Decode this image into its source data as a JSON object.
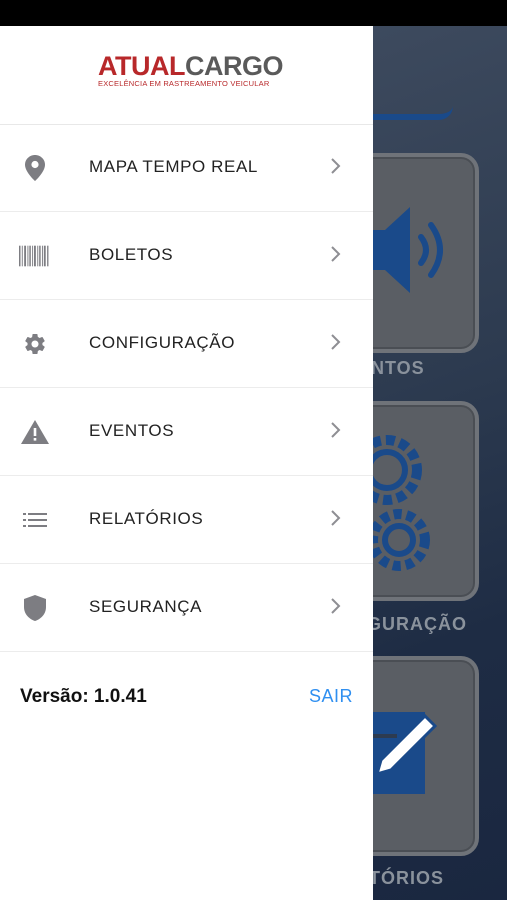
{
  "logo": {
    "part1": "ATUAL",
    "part2": "CARGO",
    "tagline": "EXCELÊNCIA EM RASTREAMENTO VEICULAR"
  },
  "menu": {
    "items": [
      {
        "label": "MAPA TEMPO REAL",
        "icon": "location-pin-icon"
      },
      {
        "label": "BOLETOS",
        "icon": "barcode-icon"
      },
      {
        "label": "CONFIGURAÇÃO",
        "icon": "gear-icon"
      },
      {
        "label": "EVENTOS",
        "icon": "warning-icon"
      },
      {
        "label": "RELATÓRIOS",
        "icon": "list-icon"
      },
      {
        "label": "SEGURANÇA",
        "icon": "shield-icon"
      }
    ]
  },
  "footer": {
    "version": "Versão: 1.0.41",
    "logout": "SAIR"
  },
  "background": {
    "labels": [
      "NTOS",
      "GURAÇÃO",
      "TÓRIOS"
    ]
  },
  "colors": {
    "brand_red": "#b8282a",
    "brand_gray": "#5a5a5a",
    "link_blue": "#2f8ff0",
    "icon_gray": "#7d7d82"
  }
}
